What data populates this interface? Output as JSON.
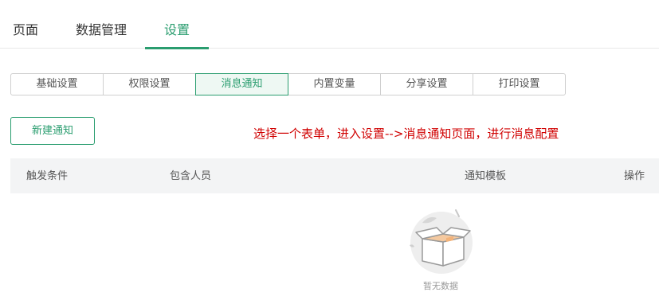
{
  "top_tabs": [
    {
      "label": "页面"
    },
    {
      "label": "数据管理"
    },
    {
      "label": "设置"
    }
  ],
  "active_top_tab": "设置",
  "sub_tabs": [
    {
      "label": "基础设置"
    },
    {
      "label": "权限设置"
    },
    {
      "label": "消息通知"
    },
    {
      "label": "内置变量"
    },
    {
      "label": "分享设置"
    },
    {
      "label": "打印设置"
    }
  ],
  "active_sub_tab": "消息通知",
  "new_button_label": "新建通知",
  "annotation": "选择一个表单，进入设置-->消息通知页面，进行消息配置",
  "table": {
    "columns": [
      "触发条件",
      "包含人员",
      "通知模板",
      "操作"
    ]
  },
  "empty_state": {
    "text": "暂无数据",
    "icon": "empty-box-icon"
  },
  "colors": {
    "accent": "#2a9d6f",
    "annotation": "#d00000"
  }
}
